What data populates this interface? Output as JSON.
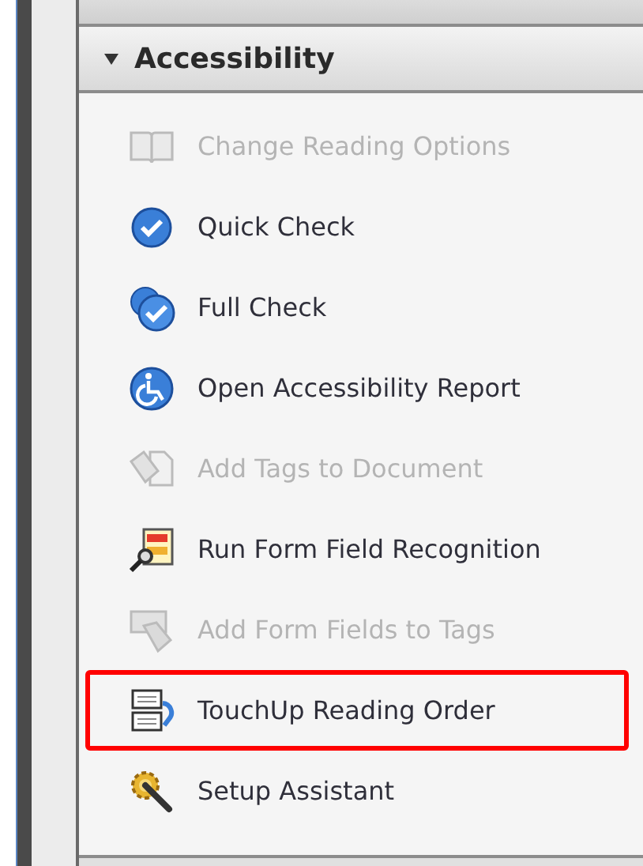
{
  "panel": {
    "title": "Accessibility",
    "expanded": true
  },
  "items": [
    {
      "label": "Change Reading Options",
      "kind": "book",
      "disabled": true,
      "highlighted": false
    },
    {
      "label": "Quick Check",
      "kind": "check",
      "disabled": false,
      "highlighted": false
    },
    {
      "label": "Full Check",
      "kind": "double-check",
      "disabled": false,
      "highlighted": false
    },
    {
      "label": "Open Accessibility Report",
      "kind": "wheelchair",
      "disabled": false,
      "highlighted": false
    },
    {
      "label": "Add Tags to Document",
      "kind": "tag-doc",
      "disabled": true,
      "highlighted": false
    },
    {
      "label": "Run Form Field Recognition",
      "kind": "form-magnifier",
      "disabled": false,
      "highlighted": false
    },
    {
      "label": "Add Form Fields to Tags",
      "kind": "tag-form",
      "disabled": true,
      "highlighted": false
    },
    {
      "label": "TouchUp Reading Order",
      "kind": "reading-order",
      "disabled": false,
      "highlighted": true
    },
    {
      "label": "Setup Assistant",
      "kind": "gear-wand",
      "disabled": false,
      "highlighted": false
    }
  ]
}
